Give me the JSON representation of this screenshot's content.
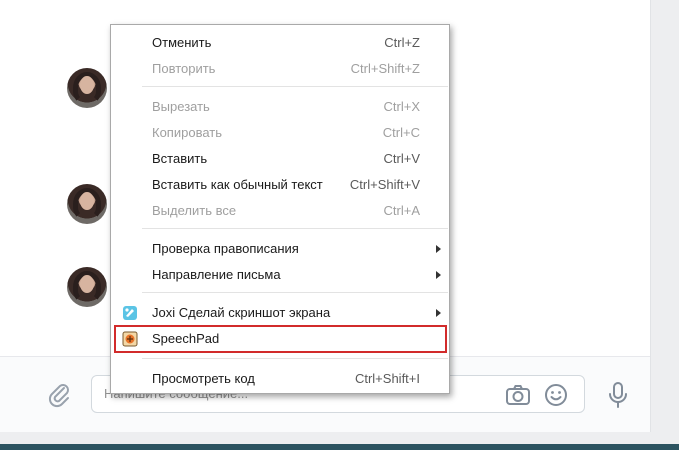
{
  "composer": {
    "placeholder": "Напишите сообщение..."
  },
  "context_menu": {
    "items": [
      {
        "label": "Отменить",
        "shortcut": "Ctrl+Z",
        "enabled": true
      },
      {
        "label": "Повторить",
        "shortcut": "Ctrl+Shift+Z",
        "enabled": false
      },
      {
        "label": "Вырезать",
        "shortcut": "Ctrl+X",
        "enabled": false
      },
      {
        "label": "Копировать",
        "shortcut": "Ctrl+C",
        "enabled": false
      },
      {
        "label": "Вставить",
        "shortcut": "Ctrl+V",
        "enabled": true
      },
      {
        "label": "Вставить как обычный текст",
        "shortcut": "Ctrl+Shift+V",
        "enabled": true
      },
      {
        "label": "Выделить все",
        "shortcut": "Ctrl+A",
        "enabled": false
      },
      {
        "label": "Проверка правописания",
        "submenu": true,
        "enabled": true
      },
      {
        "label": "Направление письма",
        "submenu": true,
        "enabled": true
      },
      {
        "label": "Joxi Сделай скриншот экрана",
        "submenu": true,
        "enabled": true,
        "icon": "joxi-icon"
      },
      {
        "label": "SpeechPad",
        "enabled": true,
        "icon": "speechpad-icon",
        "highlighted": true
      },
      {
        "label": "Просмотреть код",
        "shortcut": "Ctrl+Shift+I",
        "enabled": true
      }
    ]
  },
  "colors": {
    "highlight": "#d22b2b",
    "disabled_text": "#9f9f9f",
    "bottom_stripe": "#2c5360"
  }
}
